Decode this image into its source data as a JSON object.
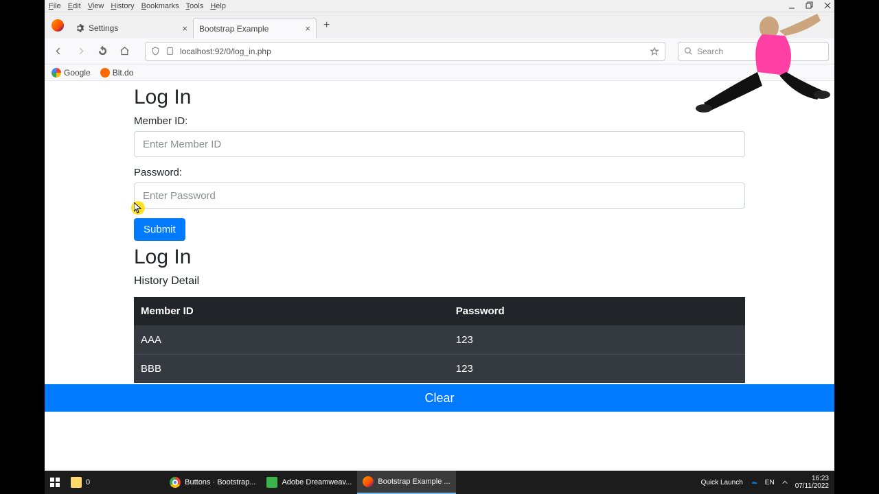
{
  "menubar": [
    "File",
    "Edit",
    "View",
    "History",
    "Bookmarks",
    "Tools",
    "Help"
  ],
  "tabs": [
    {
      "label": "Settings",
      "active": false
    },
    {
      "label": "Bootstrap Example",
      "active": true
    }
  ],
  "urlbar": {
    "url": "localhost:92/0/log_in.php"
  },
  "searchbar": {
    "placeholder": "Search"
  },
  "bookmarks": [
    {
      "label": "Google",
      "kind": "google"
    },
    {
      "label": "Bit.do",
      "kind": "bit"
    }
  ],
  "page": {
    "heading1": "Log In",
    "member_label": "Member ID:",
    "member_placeholder": "Enter Member ID",
    "password_label": "Password:",
    "password_placeholder": "Enter Password",
    "submit_label": "Submit",
    "heading2": "Log In",
    "history_label": "History Detail",
    "table": {
      "headers": [
        "Member ID",
        "Password"
      ],
      "rows": [
        [
          "AAA",
          "123"
        ],
        [
          "BBB",
          "123"
        ]
      ]
    },
    "clear_label": "Clear"
  },
  "taskbar": {
    "tray0": "0",
    "apps": [
      {
        "label": "Buttons · Bootstrap...",
        "icon": "chrome",
        "active": false
      },
      {
        "label": "Adobe Dreamweav...",
        "icon": "dw",
        "active": false
      },
      {
        "label": "Bootstrap Example ...",
        "icon": "ff",
        "active": true
      }
    ],
    "quick": "Quick Launch",
    "lang": "EN",
    "time": "16:23",
    "date": "07/11/2022"
  }
}
